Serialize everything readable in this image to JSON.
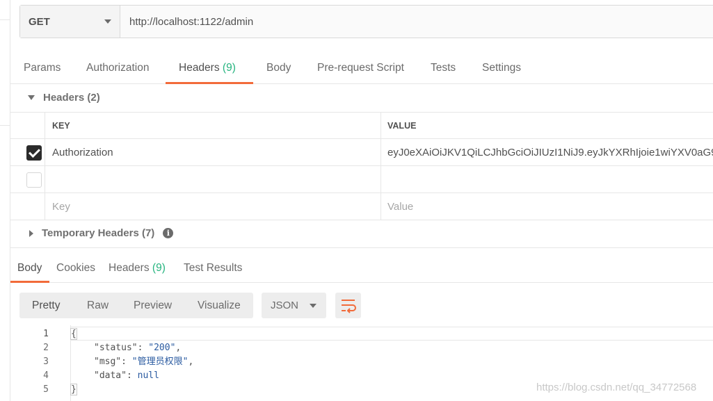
{
  "request": {
    "method": "GET",
    "url": "http://localhost:1122/admin"
  },
  "request_tabs": [
    {
      "label": "Params",
      "count": ""
    },
    {
      "label": "Authorization",
      "count": ""
    },
    {
      "label": "Headers",
      "count": "(9)"
    },
    {
      "label": "Body",
      "count": ""
    },
    {
      "label": "Pre-request Script",
      "count": ""
    },
    {
      "label": "Tests",
      "count": ""
    },
    {
      "label": "Settings",
      "count": ""
    }
  ],
  "headers_section": {
    "title": "Headers",
    "count": "(2)",
    "columns": {
      "key": "KEY",
      "value": "VALUE"
    },
    "rows": [
      {
        "checked": true,
        "key": "Authorization",
        "value": "eyJ0eXAiOiJKV1QiLCJhbGciOiJIUzI1NiJ9.eyJkYXRhIjoie1wiYXV0aG9…"
      },
      {
        "checked": false,
        "key": "",
        "value": ""
      }
    ],
    "new_row": {
      "key_placeholder": "Key",
      "value_placeholder": "Value"
    }
  },
  "temporary_headers": {
    "title": "Temporary Headers",
    "count": "(7)",
    "info_icon": "info-icon"
  },
  "response_tabs": [
    {
      "label": "Body",
      "count": ""
    },
    {
      "label": "Cookies",
      "count": ""
    },
    {
      "label": "Headers",
      "count": "(9)"
    },
    {
      "label": "Test Results",
      "count": ""
    }
  ],
  "view_modes": [
    "Pretty",
    "Raw",
    "Preview",
    "Visualize"
  ],
  "format": "JSON",
  "wrap_icon": "wrap-lines-icon",
  "code": {
    "line_numbers": [
      "1",
      "2",
      "3",
      "4",
      "5"
    ],
    "open_brace": "{",
    "close_brace": "}",
    "entries": [
      {
        "key": "\"status\"",
        "value": "\"200\"",
        "trail": ","
      },
      {
        "key": "\"msg\"",
        "value": "\"管理员权限\"",
        "trail": ","
      },
      {
        "key": "\"data\"",
        "value": "null",
        "trail": ""
      }
    ]
  },
  "watermark": "https://blog.csdn.net/qq_34772568",
  "colors": {
    "accent": "#f26b3a",
    "count_green": "#26b47f",
    "json_value": "#2a5aa0"
  }
}
